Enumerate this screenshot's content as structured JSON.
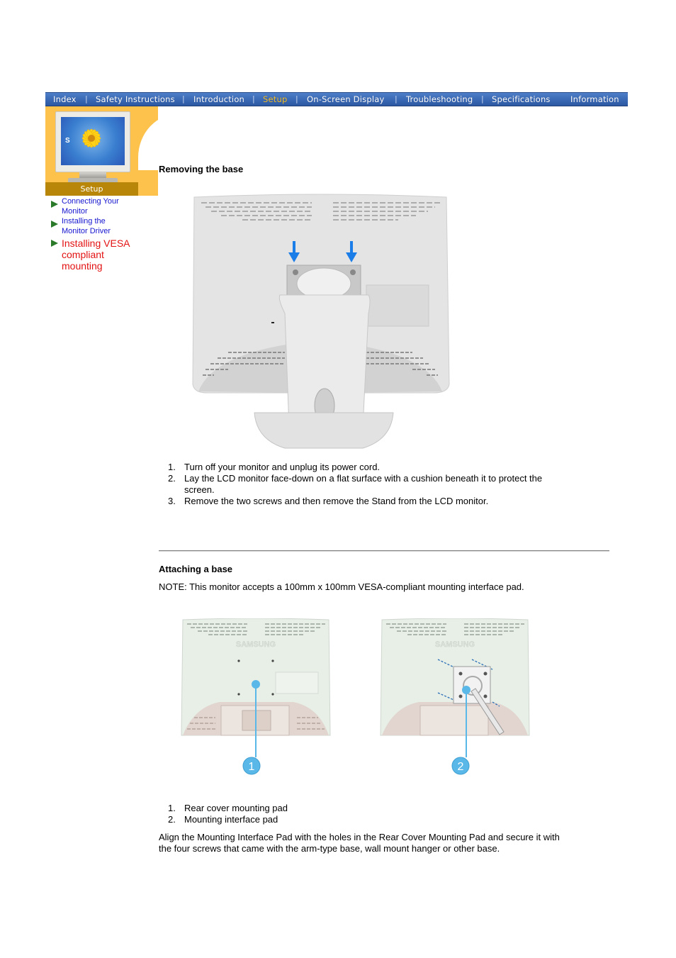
{
  "nav": {
    "items": [
      {
        "label": "Index",
        "active": false
      },
      {
        "label": "Safety Instructions",
        "active": false
      },
      {
        "label": "Introduction",
        "active": false
      },
      {
        "label": "Setup",
        "active": true
      },
      {
        "label": "On-Screen Display",
        "active": false
      },
      {
        "label": "Troubleshooting",
        "active": false
      },
      {
        "label": "Specifications",
        "active": false
      },
      {
        "label": "Information",
        "active": false
      }
    ],
    "separator": "|"
  },
  "sidebar": {
    "section_label": "Setup",
    "monitor_logo_letter": "S",
    "links": [
      {
        "label_line1": "Connecting Your",
        "label_line2": "Monitor",
        "current": false
      },
      {
        "label_line1": "Installing the",
        "label_line2": "Monitor Driver",
        "current": false
      },
      {
        "label_line1": "Installing VESA",
        "label_line2": "compliant",
        "label_line3": "mounting",
        "current": true
      }
    ]
  },
  "colors": {
    "nav_bg": "#3a68b4",
    "nav_active": "#f5c02c",
    "sidebar_yellow": "#fdc24c",
    "sidebar_label_bg": "#b8870a",
    "link_blue": "#1515d0",
    "link_current_red": "#e31212",
    "arrow_green": "#2a7a2a",
    "callout_blue": "#5ab8e8",
    "indicator_arrow_blue": "#1a7de8"
  },
  "removing": {
    "title": "Removing the base",
    "figure_alt": "Rear view of LCD monitor with stand, arrows pointing to two screws",
    "steps": [
      {
        "num": "1.",
        "text": "Turn off your monitor and unplug its power cord."
      },
      {
        "num": "2.",
        "text": "Lay the LCD monitor face-down on a flat surface with a cushion beneath it to protect the",
        "text2": "screen."
      },
      {
        "num": "3.",
        "text": "Remove the two screws and then remove the Stand from the LCD monitor."
      }
    ]
  },
  "attaching": {
    "title": "Attaching a base",
    "note": "NOTE: This monitor accepts a 100mm x 100mm VESA-compliant mounting interface pad.",
    "figures": [
      {
        "callout": "1",
        "alt": "Rear cover mounting pad",
        "brand": "SAMSUNG"
      },
      {
        "callout": "2",
        "alt": "Mounting interface pad attached",
        "brand": "SAMSUNG"
      }
    ],
    "items": [
      {
        "num": "1.",
        "text": "Rear cover mounting pad"
      },
      {
        "num": "2.",
        "text": "Mounting interface pad"
      }
    ],
    "instruction_line1": "Align the Mounting Interface Pad with the holes in the Rear Cover Mounting Pad and secure it with",
    "instruction_line2": "the four screws that came with the arm-type base, wall mount hanger or other base."
  }
}
